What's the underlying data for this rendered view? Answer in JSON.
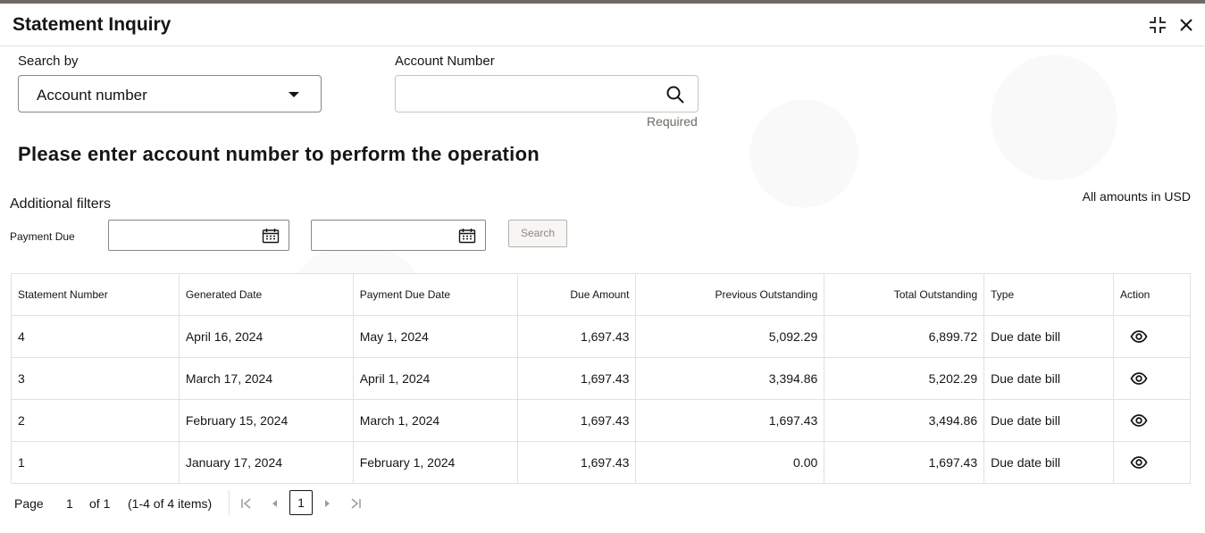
{
  "header": {
    "title": "Statement Inquiry",
    "icons": [
      "collapse-icon",
      "close-icon"
    ]
  },
  "search": {
    "search_by_label": "Search by",
    "search_by_value": "Account number",
    "account_label": "Account Number",
    "account_value": "",
    "account_placeholder": "",
    "required_text": "Required"
  },
  "prompt": "Please enter account number to perform the operation",
  "filters": {
    "title": "Additional filters",
    "amounts_note": "All amounts in USD",
    "payment_due_label": "Payment Due",
    "from_value": "",
    "to_value": "",
    "search_button": "Search"
  },
  "table": {
    "headers": [
      "Statement Number",
      "Generated Date",
      "Payment Due Date",
      "Due Amount",
      "Previous Outstanding",
      "Total Outstanding",
      "Type",
      "Action"
    ],
    "rows": [
      [
        "4",
        "April 16, 2024",
        "May 1, 2024",
        "1,697.43",
        "5,092.29",
        "6,899.72",
        "Due date bill"
      ],
      [
        "3",
        "March 17, 2024",
        "April 1, 2024",
        "1,697.43",
        "3,394.86",
        "5,202.29",
        "Due date bill"
      ],
      [
        "2",
        "February 15, 2024",
        "March 1, 2024",
        "1,697.43",
        "1,697.43",
        "3,494.86",
        "Due date bill"
      ],
      [
        "1",
        "January 17, 2024",
        "February 1, 2024",
        "1,697.43",
        "0.00",
        "1,697.43",
        "Due date bill"
      ]
    ]
  },
  "pager": {
    "page_label": "Page",
    "page": "1",
    "of_text": "of 1",
    "items_text": "(1-4 of 4 items)",
    "current": "1"
  },
  "colors": {
    "text": "#161513",
    "border": "#e4e1dc",
    "muted": "#6f6a64"
  }
}
